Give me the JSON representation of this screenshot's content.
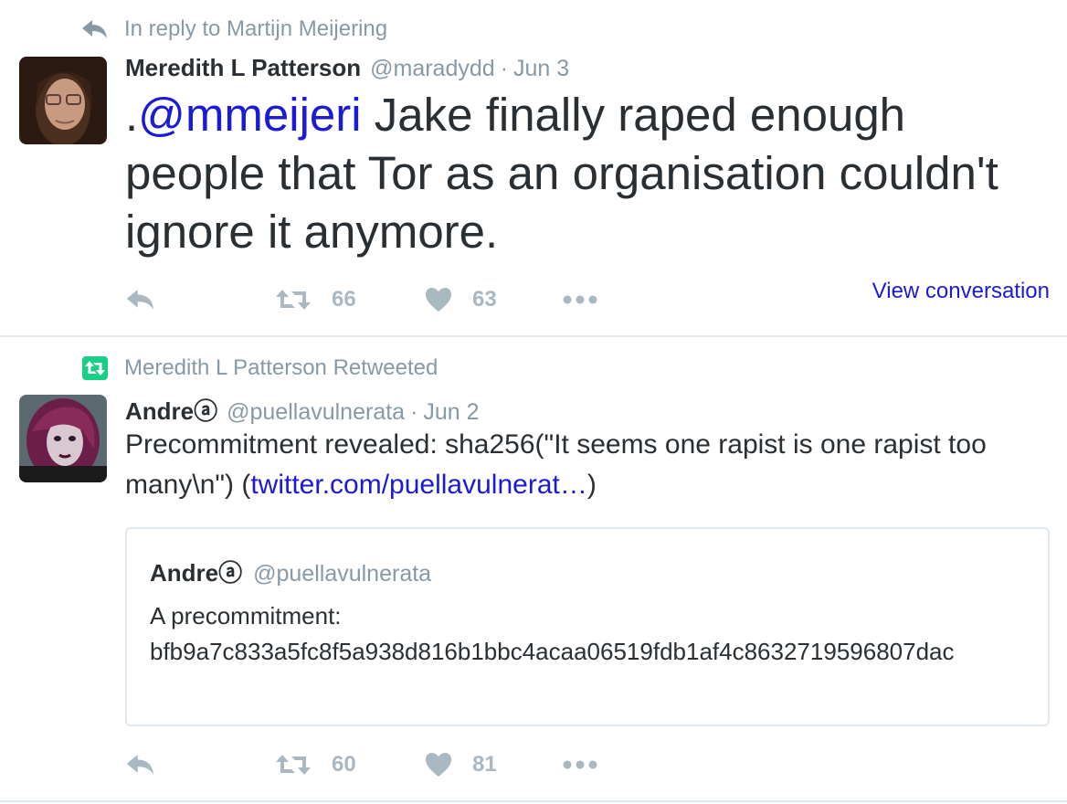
{
  "tweets": [
    {
      "context": "In reply to Martijn Meijering",
      "context_icon": "reply-icon",
      "fullname": "Meredith L Patterson",
      "handle": "@maradydd",
      "separator": "·",
      "date": "Jun 3",
      "text_prefix": ".",
      "mention": "@mmeijeri",
      "text_rest": " Jake finally raped enough people that Tor as an organisation couldn't ignore it anymore.",
      "retweets": "66",
      "likes": "63",
      "view_conversation": "View conversation"
    },
    {
      "context": "Meredith L Patterson Retweeted",
      "context_icon": "retweet-badge-icon",
      "fullname": "Andreⓐ",
      "handle": "@puellavulnerata",
      "separator": "·",
      "date": "Jun 2",
      "text_prefix": "Precommitment revealed: sha256(\"It seems one rapist is one rapist too many\\n\") (",
      "link": "twitter.com/puellavulnerat…",
      "text_suffix": ")",
      "quote": {
        "fullname": "Andreⓐ",
        "handle": "@puellavulnerata",
        "text_line1": "A precommitment:",
        "text_line2": "bfb9a7c833a5fc8f5a938d816b1bbc4acaa06519fdb1af4c8632719596807dac"
      },
      "retweets": "60",
      "likes": "81"
    }
  ],
  "colors": {
    "text": "#292f33",
    "muted": "#8899a6",
    "action": "#aab8c2",
    "link": "#1b1bd6",
    "retweet_green": "#19cf86",
    "divider": "#e1e8ed"
  }
}
